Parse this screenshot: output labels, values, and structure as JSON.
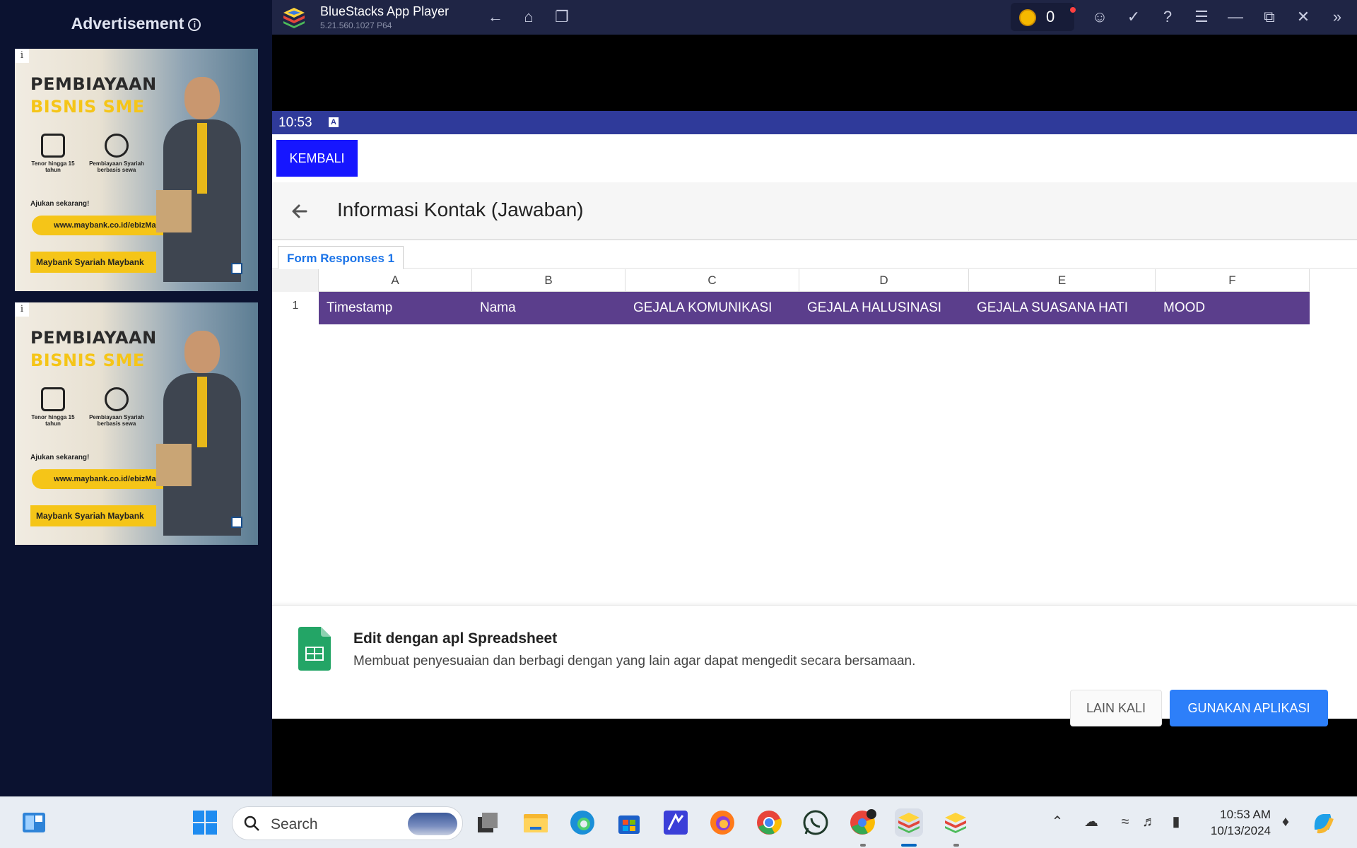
{
  "ad_panel": {
    "title": "Advertisement",
    "info_icon": "info-icon",
    "cards": [
      {
        "headline_1": "PEMBIAYAAN",
        "headline_2": "BISNIS SME",
        "feature_1": "Tenor hingga 15 tahun",
        "feature_2": "Pembiayaan Syariah berbasis sewa",
        "cta": "Ajukan sekarang!",
        "url": "www.maybank.co.id/ebizMaxi",
        "logos": "Maybank Syariah   Maybank"
      },
      {
        "headline_1": "PEMBIAYAAN",
        "headline_2": "BISNIS SME",
        "feature_1": "Tenor hingga 15 tahun",
        "feature_2": "Pembiayaan Syariah berbasis sewa",
        "cta": "Ajukan sekarang!",
        "url": "www.maybank.co.id/ebizMaxi",
        "logos": "Maybank Syariah   Maybank"
      }
    ]
  },
  "titlebar": {
    "app_name": "BlueStacks App Player",
    "version": "5.21.560.1027  P64",
    "coin_count": "0",
    "icons": [
      "back-icon",
      "home-icon",
      "recent-apps-icon",
      "account-icon",
      "eco-mode-icon",
      "help-icon",
      "menu-icon",
      "minimize-icon",
      "restore-icon",
      "close-icon",
      "sidebar-toggle-icon"
    ]
  },
  "android": {
    "status_time": "10:53",
    "kembali_label": "KEMBALI",
    "sheet_title": "Informasi Kontak (Jawaban)",
    "sheet_tab": "Form Responses 1",
    "columns": [
      "A",
      "B",
      "C",
      "D",
      "E",
      "F"
    ],
    "row_number": "1",
    "header_cells": [
      "Timestamp",
      "Nama",
      "GEJALA KOMUNIKASI",
      "GEJALA HALUSINASI",
      "GEJALA SUASANA HATI",
      "MOOD"
    ],
    "header_row_color": "#5b3e8c",
    "banner": {
      "title": "Edit dengan apl Spreadsheet",
      "description": "Membuat penyesuaian dan berbagi dengan yang lain agar dapat mengedit secara bersamaan.",
      "later_label": "LAIN KALI",
      "use_label": "GUNAKAN APLIKASI",
      "accent": "#2d7ff9"
    }
  },
  "taskbar": {
    "search_placeholder": "Search",
    "time": "10:53 AM",
    "date": "10/13/2024",
    "apps": [
      "widgets-icon",
      "start-icon",
      "task-view-icon",
      "file-explorer-icon",
      "edge-icon",
      "store-icon",
      "app-icon",
      "firefox-icon",
      "chrome-icon",
      "whatsapp-icon",
      "chrome-profile-icon",
      "bluestacks-icon",
      "bluestacks-multi-icon"
    ]
  }
}
